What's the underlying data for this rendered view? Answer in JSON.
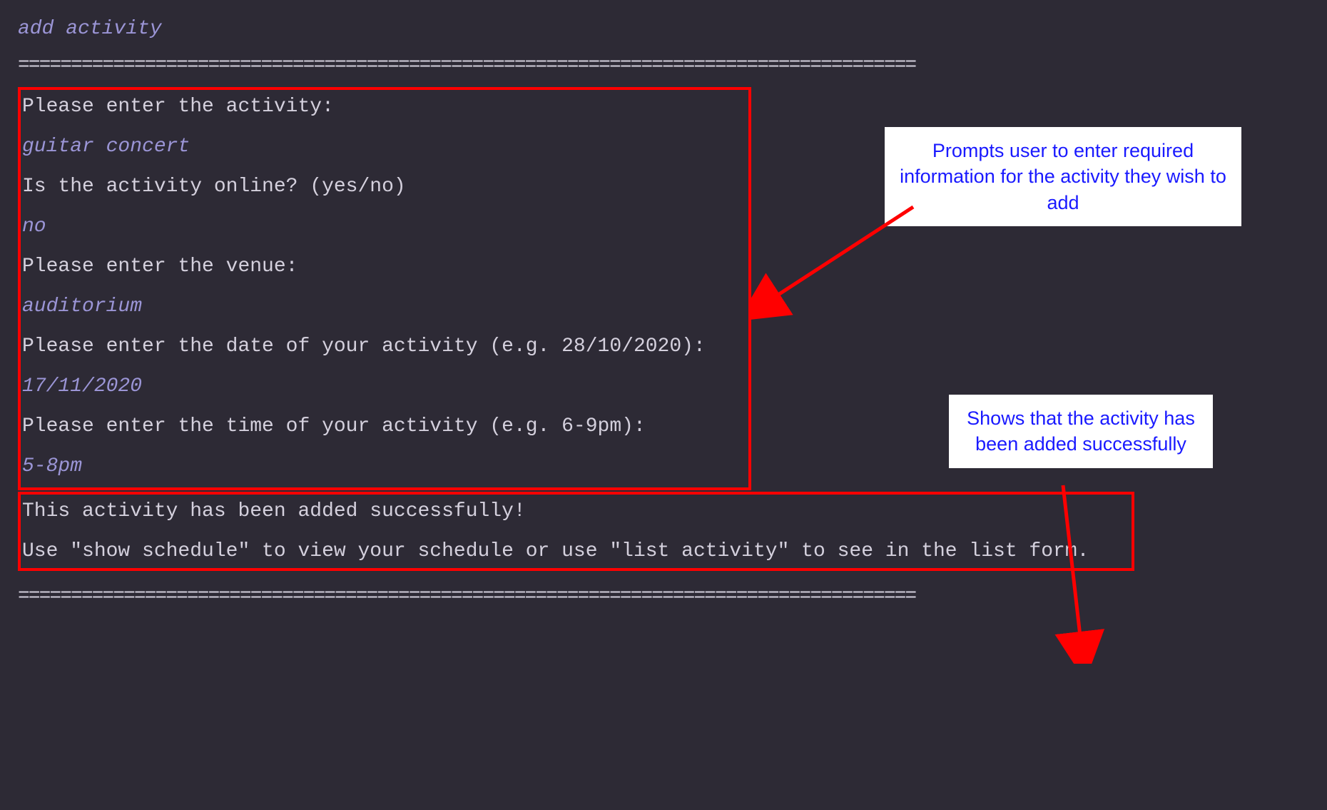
{
  "command": "add activity",
  "divider": "=====================================================================================",
  "prompts": {
    "activity": "Please enter the activity:",
    "online": "Is the activity online? (yes/no)",
    "venue": "Please enter the venue:",
    "date": "Please enter the date of your activity (e.g. 28/10/2020):",
    "time": "Please enter the time of your activity (e.g. 6-9pm):"
  },
  "inputs": {
    "activity": "guitar concert",
    "online": "no",
    "venue": "auditorium",
    "date": "17/11/2020",
    "time": "5-8pm"
  },
  "success": {
    "line1": "This activity has been added successfully!",
    "line2": "Use \"show schedule\" to view your schedule or use \"list activity\" to see in the list form."
  },
  "callouts": {
    "prompts": "Prompts user to enter required information for the activity they wish to add",
    "success": "Shows that the activity has been added successfully"
  }
}
